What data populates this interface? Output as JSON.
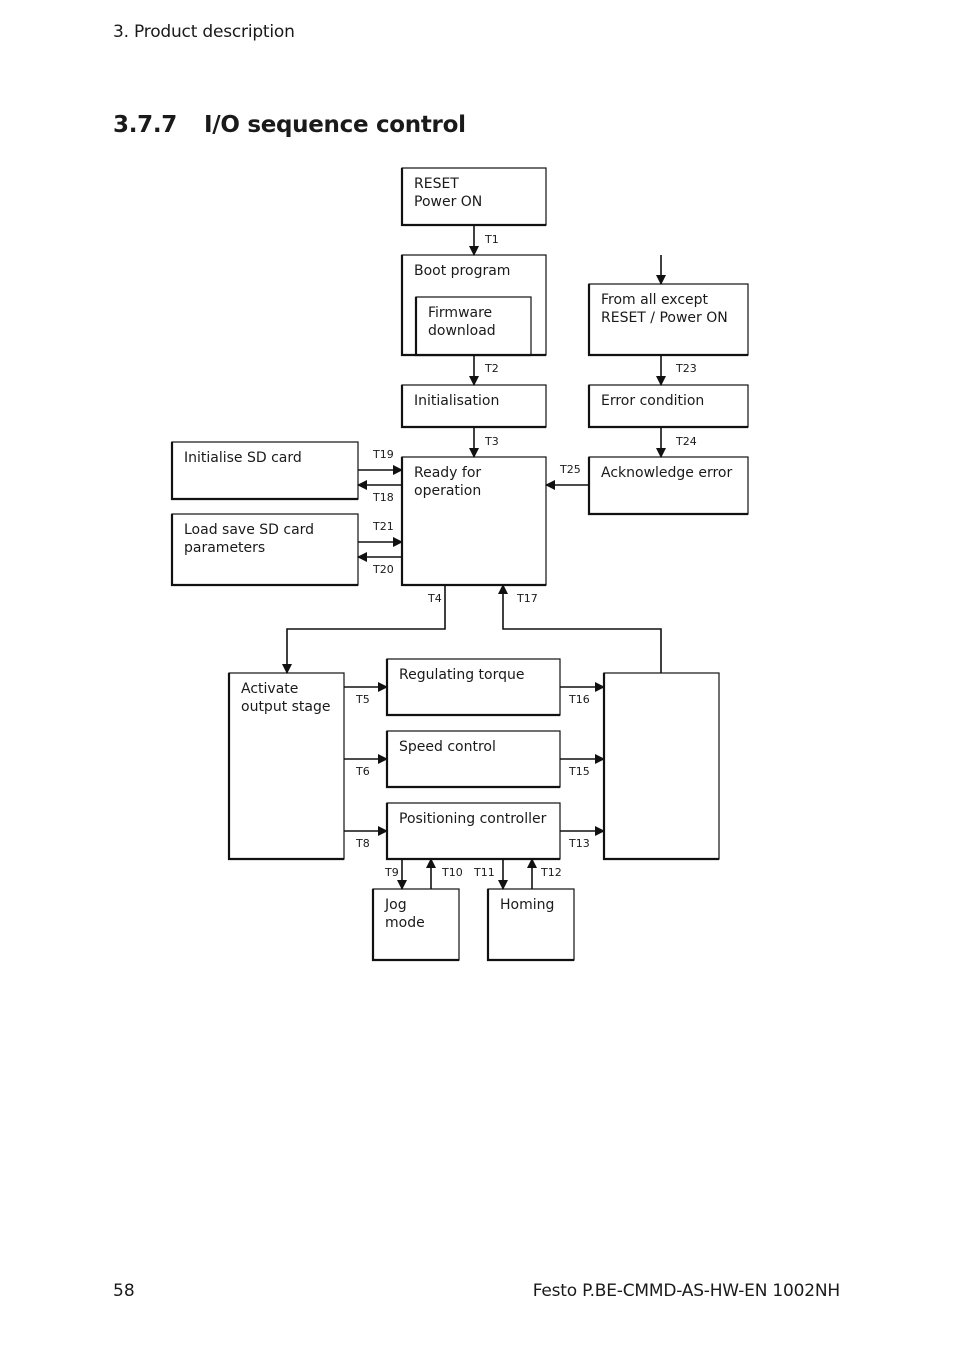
{
  "header": {
    "running_head": "3. Product description",
    "section_number": "3.7.7",
    "section_title": "I/O sequence control"
  },
  "diagram": {
    "states": {
      "reset_power_on": [
        "RESET",
        "Power ON"
      ],
      "boot_program": [
        "Boot program"
      ],
      "firmware_download": [
        "Firmware",
        "download"
      ],
      "from_all_except": [
        "From all except",
        "RESET / Power ON"
      ],
      "initialisation": [
        "Initialisation"
      ],
      "error_condition": [
        "Error condition"
      ],
      "initialise_sd_card": [
        "Initialise SD card"
      ],
      "ready_for_operation": [
        "Ready for",
        "operation"
      ],
      "acknowledge_error": [
        "Acknowledge error"
      ],
      "load_save_sd_card": [
        "Load save SD card",
        "parameters"
      ],
      "activate_output_stage": [
        "Activate",
        "output stage"
      ],
      "regulating_torque": [
        "Regulating torque"
      ],
      "speed_control": [
        "Speed control"
      ],
      "positioning_controller": [
        "Positioning controller"
      ],
      "jog_mode": [
        "Jog",
        "mode"
      ],
      "homing": [
        "Homing"
      ],
      "collector": []
    },
    "transitions": [
      {
        "id": "T1",
        "from": "reset_power_on",
        "to": "boot_program"
      },
      {
        "id": "T2",
        "from": "boot_program",
        "to": "initialisation"
      },
      {
        "id": "T3",
        "from": "initialisation",
        "to": "ready_for_operation"
      },
      {
        "id": "T4",
        "from": "ready_for_operation",
        "to": "activate_output_stage"
      },
      {
        "id": "T5",
        "from": "activate_output_stage",
        "to": "regulating_torque"
      },
      {
        "id": "T6",
        "from": "activate_output_stage",
        "to": "speed_control"
      },
      {
        "id": "T8",
        "from": "activate_output_stage",
        "to": "positioning_controller"
      },
      {
        "id": "T9",
        "from": "positioning_controller",
        "to": "jog_mode"
      },
      {
        "id": "T10",
        "from": "jog_mode",
        "to": "positioning_controller"
      },
      {
        "id": "T11",
        "from": "positioning_controller",
        "to": "homing"
      },
      {
        "id": "T12",
        "from": "homing",
        "to": "positioning_controller"
      },
      {
        "id": "T13",
        "from": "positioning_controller",
        "to": "collector"
      },
      {
        "id": "T15",
        "from": "speed_control",
        "to": "collector"
      },
      {
        "id": "T16",
        "from": "regulating_torque",
        "to": "collector"
      },
      {
        "id": "T17",
        "from": "collector",
        "to": "ready_for_operation"
      },
      {
        "id": "T18",
        "from": "ready_for_operation",
        "to": "initialise_sd_card"
      },
      {
        "id": "T19",
        "from": "initialise_sd_card",
        "to": "ready_for_operation"
      },
      {
        "id": "T20",
        "from": "ready_for_operation",
        "to": "load_save_sd_card"
      },
      {
        "id": "T21",
        "from": "load_save_sd_card",
        "to": "ready_for_operation"
      },
      {
        "id": "T23",
        "from": "from_all_except",
        "to": "error_condition"
      },
      {
        "id": "T24",
        "from": "error_condition",
        "to": "acknowledge_error"
      },
      {
        "id": "T25",
        "from": "acknowledge_error",
        "to": "ready_for_operation"
      }
    ]
  },
  "footer": {
    "page_number": "58",
    "document_id": "Festo P.BE-CMMD-AS-HW-EN 1002NH"
  }
}
